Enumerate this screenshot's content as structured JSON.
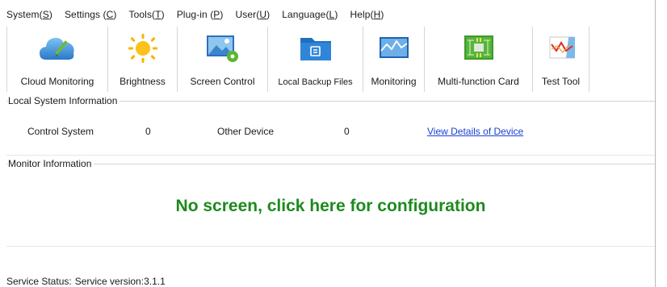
{
  "menu": [
    {
      "label": "System(",
      "key": "S",
      "tail": ")"
    },
    {
      "label": "Settings (",
      "key": "C",
      "tail": ")"
    },
    {
      "label": "Tools(",
      "key": "T",
      "tail": ")"
    },
    {
      "label": "Plug-in (",
      "key": "P",
      "tail": ")"
    },
    {
      "label": "User(",
      "key": "U",
      "tail": ")"
    },
    {
      "label": "Language(",
      "key": "L",
      "tail": ")"
    },
    {
      "label": "Help(",
      "key": "H",
      "tail": ")"
    }
  ],
  "toolbar": [
    {
      "label": "Cloud Monitoring",
      "icon": "cloud-icon"
    },
    {
      "label": "Brightness",
      "icon": "sun-icon"
    },
    {
      "label": "Screen Control",
      "icon": "screen-gear-icon"
    },
    {
      "label": "Local Backup Files",
      "icon": "folder-icon"
    },
    {
      "label": "Monitoring",
      "icon": "monitor-chart-icon"
    },
    {
      "label": "Multi-function Card",
      "icon": "circuit-board-icon"
    },
    {
      "label": "Test Tool",
      "icon": "test-chart-icon"
    }
  ],
  "local_system": {
    "title": "Local System Information",
    "control_label": "Control System",
    "control_value": "0",
    "other_label": "Other Device",
    "other_value": "0",
    "details_link": "View Details of Device"
  },
  "monitor": {
    "title": "Monitor Information",
    "message": "No screen, click here for configuration"
  },
  "status": {
    "label": "Service Status:",
    "version": "Service version:3.1.1"
  },
  "colors": {
    "link": "#1a3fd6",
    "message": "#1d8a1d"
  }
}
